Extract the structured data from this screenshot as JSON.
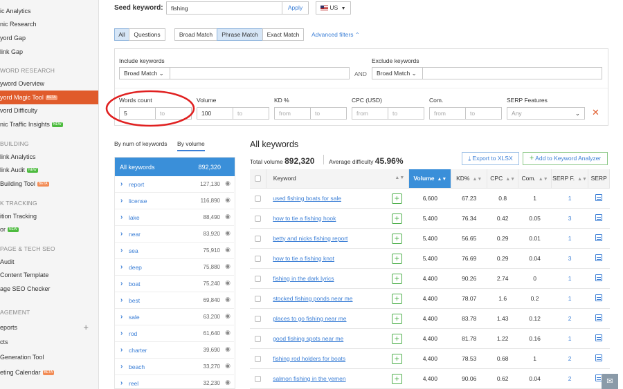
{
  "sidebar": {
    "items": [
      {
        "label": "ic Analytics"
      },
      {
        "label": "nic Research"
      },
      {
        "label": "yord Gap"
      },
      {
        "label": "link Gap"
      }
    ],
    "sec_kw": "WORD RESEARCH",
    "kw_items": [
      {
        "label": "yword Overview"
      },
      {
        "label": "yord Magic Tool",
        "badge": "BETA"
      },
      {
        "label": "vord Difficulty"
      },
      {
        "label": "nic Traffic Insights",
        "badge": "NEW"
      }
    ],
    "sec_link": "BUILDING",
    "link_items": [
      {
        "label": "link Analytics"
      },
      {
        "label": "link Audit",
        "badge": "NEW"
      },
      {
        "label": "Building Tool",
        "badge": "BETA"
      }
    ],
    "sec_track": "K TRACKING",
    "track_items": [
      {
        "label": "ition Tracking"
      },
      {
        "label": "or",
        "badge": "NEW"
      }
    ],
    "sec_seo": "PAGE & TECH SEO",
    "seo_items": [
      {
        "label": "Audit"
      },
      {
        "label": "Content Template"
      },
      {
        "label": "age SEO Checker"
      }
    ],
    "sec_mgmt": "AGEMENT",
    "mgmt_items": [
      {
        "label": "eports"
      },
      {
        "label": "cts"
      },
      {
        "label": "Generation Tool"
      },
      {
        "label": "eting Calendar",
        "badge": "BETA"
      }
    ],
    "add_icon": "plus-icon"
  },
  "search": {
    "label": "Seed keyword:",
    "value": "fishing",
    "apply": "Apply",
    "db": "US",
    "flag_icon": "us-flag-icon"
  },
  "tabs": {
    "all": "All",
    "questions": "Questions",
    "broad": "Broad Match",
    "phrase": "Phrase Match",
    "exact": "Exact Match",
    "advanced": "Advanced filters"
  },
  "filters": {
    "include_label": "Include keywords",
    "include_match": "Broad Match",
    "and": "AND",
    "exclude_label": "Exclude keywords",
    "exclude_match": "Broad Match",
    "words_label": "Words count",
    "words_from": "5",
    "words_to_ph": "to",
    "volume_label": "Volume",
    "volume_from": "100",
    "volume_to_ph": "to",
    "kd_label": "KD %",
    "kd_from_ph": "from",
    "kd_to_ph": "to",
    "cpc_label": "CPC (USD)",
    "cpc_from_ph": "from",
    "cpc_to_ph": "to",
    "com_label": "Com.",
    "com_from_ph": "from",
    "com_to_ph": "to",
    "serp_label": "SERP Features",
    "serp_value": "Any",
    "clear_icon": "close-icon"
  },
  "groups": {
    "tab_num": "By num of keywords",
    "tab_vol": "By volume",
    "all_label": "All keywords",
    "all_count": "892,320",
    "items": [
      {
        "name": "report",
        "count": "127,130"
      },
      {
        "name": "license",
        "count": "116,890"
      },
      {
        "name": "lake",
        "count": "88,490"
      },
      {
        "name": "near",
        "count": "83,920"
      },
      {
        "name": "sea",
        "count": "75,910"
      },
      {
        "name": "deep",
        "count": "75,880"
      },
      {
        "name": "boat",
        "count": "75,240"
      },
      {
        "name": "best",
        "count": "69,840"
      },
      {
        "name": "sale",
        "count": "63,200"
      },
      {
        "name": "rod",
        "count": "61,640"
      },
      {
        "name": "charter",
        "count": "39,690"
      },
      {
        "name": "beach",
        "count": "33,270"
      },
      {
        "name": "reel",
        "count": "32,230"
      }
    ]
  },
  "results": {
    "title": "All keywords",
    "total_label": "Total volume",
    "total_value": "892,320",
    "avg_label": "Average difficulty",
    "avg_value": "45.96%",
    "export": "Export to XLSX",
    "add": "Add to Keyword Analyzer",
    "columns": [
      "Keyword",
      "Volume",
      "KD%",
      "CPC",
      "Com.",
      "SERP F.",
      "SERP"
    ],
    "rows": [
      {
        "keyword": "used fishing boats for sale",
        "volume": "6,600",
        "kd": "67.23",
        "cpc": "0.8",
        "com": "1",
        "serpf": "1"
      },
      {
        "keyword": "how to tie a fishing hook",
        "volume": "5,400",
        "kd": "76.34",
        "cpc": "0.42",
        "com": "0.05",
        "serpf": "3"
      },
      {
        "keyword": "betty and nicks fishing report",
        "volume": "5,400",
        "kd": "56.65",
        "cpc": "0.29",
        "com": "0.01",
        "serpf": "1"
      },
      {
        "keyword": "how to tie a fishing knot",
        "volume": "5,400",
        "kd": "76.69",
        "cpc": "0.29",
        "com": "0.04",
        "serpf": "3"
      },
      {
        "keyword": "fishing in the dark lyrics",
        "volume": "4,400",
        "kd": "90.26",
        "cpc": "2.74",
        "com": "0",
        "serpf": "1"
      },
      {
        "keyword": "stocked fishing ponds near me",
        "volume": "4,400",
        "kd": "78.07",
        "cpc": "1.6",
        "com": "0.2",
        "serpf": "1"
      },
      {
        "keyword": "places to go fishing near me",
        "volume": "4,400",
        "kd": "83.78",
        "cpc": "1.43",
        "com": "0.12",
        "serpf": "2"
      },
      {
        "keyword": "good fishing spots near me",
        "volume": "4,400",
        "kd": "81.78",
        "cpc": "1.22",
        "com": "0.16",
        "serpf": "1"
      },
      {
        "keyword": "fishing rod holders for boats",
        "volume": "4,400",
        "kd": "78.53",
        "cpc": "0.68",
        "com": "1",
        "serpf": "2"
      },
      {
        "keyword": "salmon fishing in the yemen",
        "volume": "4,400",
        "kd": "90.06",
        "cpc": "0.62",
        "com": "0.04",
        "serpf": "2"
      }
    ]
  },
  "highlight_color": "#e02020",
  "accent": "#3a8fd9",
  "brand": "#e05b2b"
}
